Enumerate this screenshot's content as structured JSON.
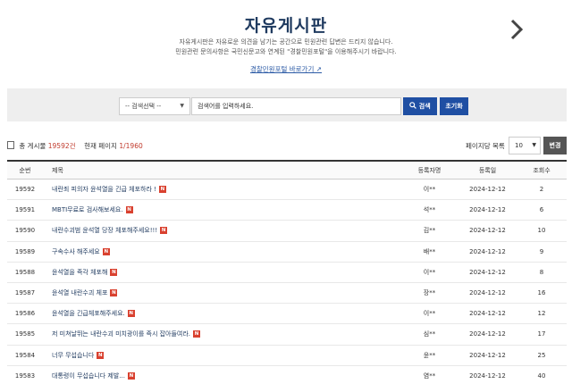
{
  "header": {
    "title": "자유게시판",
    "desc_line1": "자유게시판은 자유로운 의견을 남기는 공간으로 민원관련 답변은 드리지 않습니다.",
    "desc_line2": "민원관련 문의사항은 국민신문고와 연계된 \"경찰민원포털\"을 이용해주시기 바랍니다.",
    "portal_link": "경찰민원포털 바로가기 ↗"
  },
  "search": {
    "select_value": "-- 검색선택 --",
    "input_placeholder": "검색어를 입력하세요.",
    "search_button": "검색",
    "reset_button": "초기화"
  },
  "summary": {
    "total_label": "총 게시물",
    "total_count": "19592건",
    "page_label": "현재 페이지",
    "page_value": "1/1960"
  },
  "per_page": {
    "label": "페이지당 목록",
    "value": "10",
    "change_button": "변경"
  },
  "table": {
    "headers": {
      "no": "순번",
      "title": "제목",
      "author": "등록자명",
      "date": "등록일",
      "views": "조회수"
    },
    "rows": [
      {
        "no": "19592",
        "title": "내란죄 피의자 윤석열을 긴급 체포하라 !",
        "new": "N",
        "author": "이**",
        "date": "2024-12-12",
        "views": "2"
      },
      {
        "no": "19591",
        "title": "MBTI무료로 검사해보세요.",
        "new": "N",
        "author": "석**",
        "date": "2024-12-12",
        "views": "6"
      },
      {
        "no": "19590",
        "title": "내란수괴범 윤석열 당장 체포해주세요!!!",
        "new": "N",
        "author": "김**",
        "date": "2024-12-12",
        "views": "10"
      },
      {
        "no": "19589",
        "title": "구속수사 해주세요",
        "new": "N",
        "author": "배**",
        "date": "2024-12-12",
        "views": "9"
      },
      {
        "no": "19588",
        "title": "윤석열을 즉각 체포해",
        "new": "N",
        "author": "이**",
        "date": "2024-12-12",
        "views": "8"
      },
      {
        "no": "19587",
        "title": "윤석열 내란수괴 체포",
        "new": "N",
        "author": "장**",
        "date": "2024-12-12",
        "views": "16"
      },
      {
        "no": "19586",
        "title": "윤석열을 긴급체포해주세요.",
        "new": "N",
        "author": "이**",
        "date": "2024-12-12",
        "views": "12"
      },
      {
        "no": "19585",
        "title": "저 미쳐날뛰는 내란수괴 미치광이를 즉시 잡아들여라.",
        "new": "N",
        "author": "심**",
        "date": "2024-12-12",
        "views": "17"
      },
      {
        "no": "19584",
        "title": "너무 무섭습니다",
        "new": "N",
        "author": "윤**",
        "date": "2024-12-12",
        "views": "25"
      },
      {
        "no": "19583",
        "title": "대통령이 무섭습니다 제발...",
        "new": "N",
        "author": "염**",
        "date": "2024-12-12",
        "views": "40"
      }
    ]
  }
}
